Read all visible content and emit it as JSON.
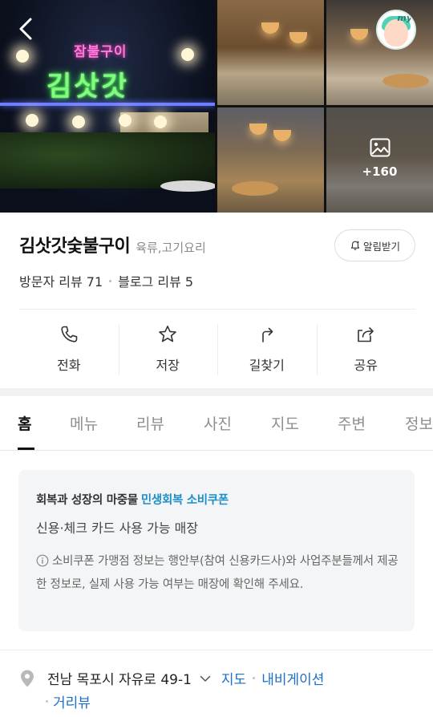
{
  "hero": {
    "sign_small": "잠불구이",
    "sign_big": "김삿갓",
    "photo_count": "+160",
    "my_badge": "my"
  },
  "place": {
    "name": "김삿갓숯불구이",
    "category": "육류,고기요리",
    "alarm_label": "알림받기",
    "visitor_review": "방문자 리뷰 71",
    "blog_review": "블로그 리뷰 5"
  },
  "actions": [
    {
      "label": "전화",
      "icon": "phone-icon"
    },
    {
      "label": "저장",
      "icon": "star-icon"
    },
    {
      "label": "길찾기",
      "icon": "directions-icon"
    },
    {
      "label": "공유",
      "icon": "share-icon"
    }
  ],
  "tabs": [
    "홈",
    "메뉴",
    "리뷰",
    "사진",
    "지도",
    "주변",
    "정보"
  ],
  "active_tab": "홈",
  "coupon": {
    "line1_prefix": "회복과 성장의 마중물",
    "line1_highlight": "민생회복 소비쿠폰",
    "line2": "신용·체크 카드 사용 가능 매장",
    "line3": "소비쿠폰 가맹점 정보는 행안부(참여 신용카드사)와 사업주분들께서 제공한 정보로, 실제 사용 가능 여부는 매장에 확인해 주세요."
  },
  "address": {
    "text": "전남 목포시 자유로 49-1",
    "map_link": "지도",
    "navigation_link": "내비게이션",
    "distance_link": "거리뷰"
  },
  "colors": {
    "link": "#1a6fc7",
    "coupon_highlight": "#1d8ec7",
    "coupon_bg": "#f4f5f7"
  }
}
